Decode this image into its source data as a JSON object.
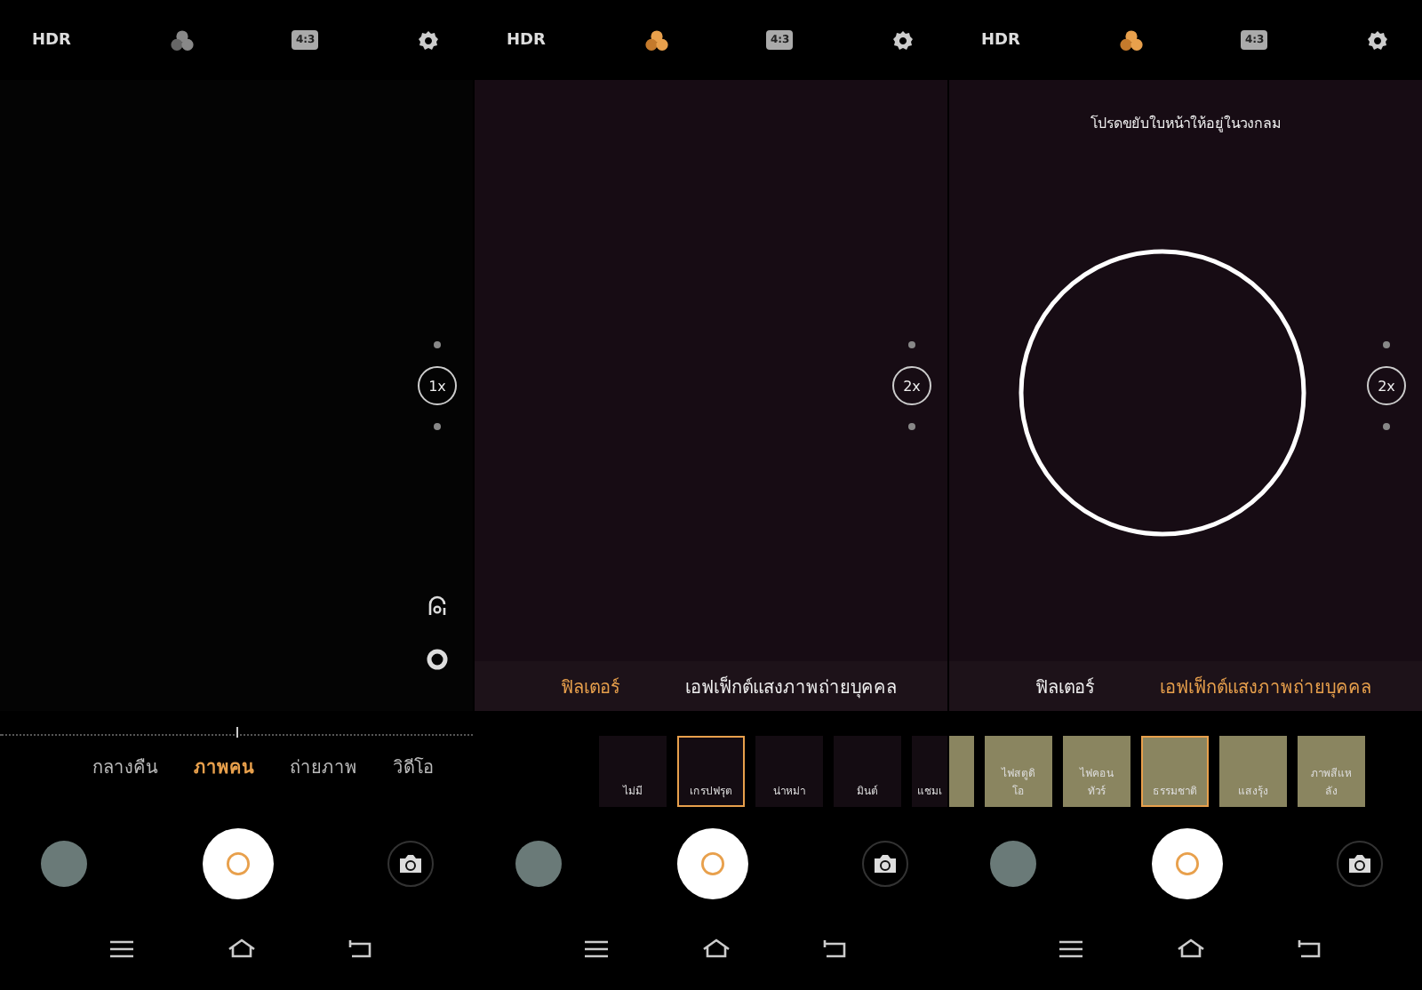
{
  "panels": [
    {
      "kind": "modes",
      "top_bar": {
        "hdr": "HDR",
        "filter_active": false,
        "aspect": "4:3"
      },
      "zoom": "1x",
      "modes": [
        {
          "label": "กลางคืน",
          "selected": false
        },
        {
          "label": "ภาพคน",
          "selected": true
        },
        {
          "label": "ถ่ายภาพ",
          "selected": false
        },
        {
          "label": "วิดีโอ",
          "selected": false
        }
      ]
    },
    {
      "kind": "filters",
      "top_bar": {
        "hdr": "HDR",
        "filter_active": true,
        "aspect": "4:3"
      },
      "zoom": "2x",
      "effect_tabs": [
        {
          "label": "ฟิลเตอร์",
          "selected": true
        },
        {
          "label": "เอฟเฟ็กต์แสงภาพถ่ายบุคคล",
          "selected": false
        }
      ],
      "tiles": [
        {
          "label": "ไม่มี",
          "selected": false
        },
        {
          "label": "เกรปฟรุต",
          "selected": true
        },
        {
          "label": "น่าหม่า",
          "selected": false
        },
        {
          "label": "มินต์",
          "selected": false
        },
        {
          "label": "แชมเ",
          "selected": false
        }
      ]
    },
    {
      "kind": "lighting",
      "top_bar": {
        "hdr": "HDR",
        "filter_active": true,
        "aspect": "4:3"
      },
      "zoom": "2x",
      "prompt": "โปรดขยับใบหน้าให้อยู่ในวงกลม",
      "effect_tabs": [
        {
          "label": "ฟิลเตอร์",
          "selected": false
        },
        {
          "label": "เอฟเฟ็กต์แสงภาพถ่ายบุคคล",
          "selected": true
        }
      ],
      "tiles": [
        {
          "label": "ไฟสตูดิโอ",
          "selected": false
        },
        {
          "label": "ไฟคอนทัวร์",
          "selected": false
        },
        {
          "label": "ธรรมชาติ",
          "selected": true
        },
        {
          "label": "แสงรุ้ง",
          "selected": false
        },
        {
          "label": "ภาพสีแหลัง",
          "selected": false
        }
      ]
    }
  ]
}
